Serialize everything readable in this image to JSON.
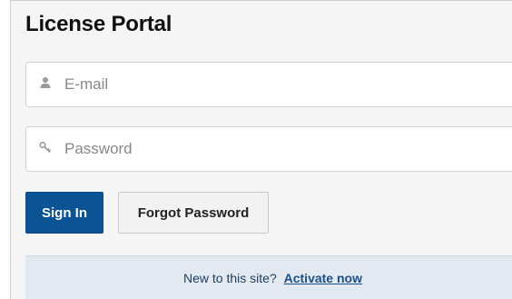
{
  "page": {
    "title": "License Portal"
  },
  "form": {
    "email": {
      "placeholder": "E-mail",
      "value": "",
      "icon": "user-icon"
    },
    "password": {
      "placeholder": "Password",
      "value": "",
      "icon": "key-icon"
    }
  },
  "buttons": {
    "sign_in": "Sign In",
    "forgot_password": "Forgot Password"
  },
  "activate": {
    "prompt": "New to this site?",
    "link": "Activate now"
  },
  "colors": {
    "primary": "#0a5496",
    "panel_bg": "#f5f5f5",
    "activate_bg": "#e2e9f0",
    "link": "#1c4f86"
  }
}
